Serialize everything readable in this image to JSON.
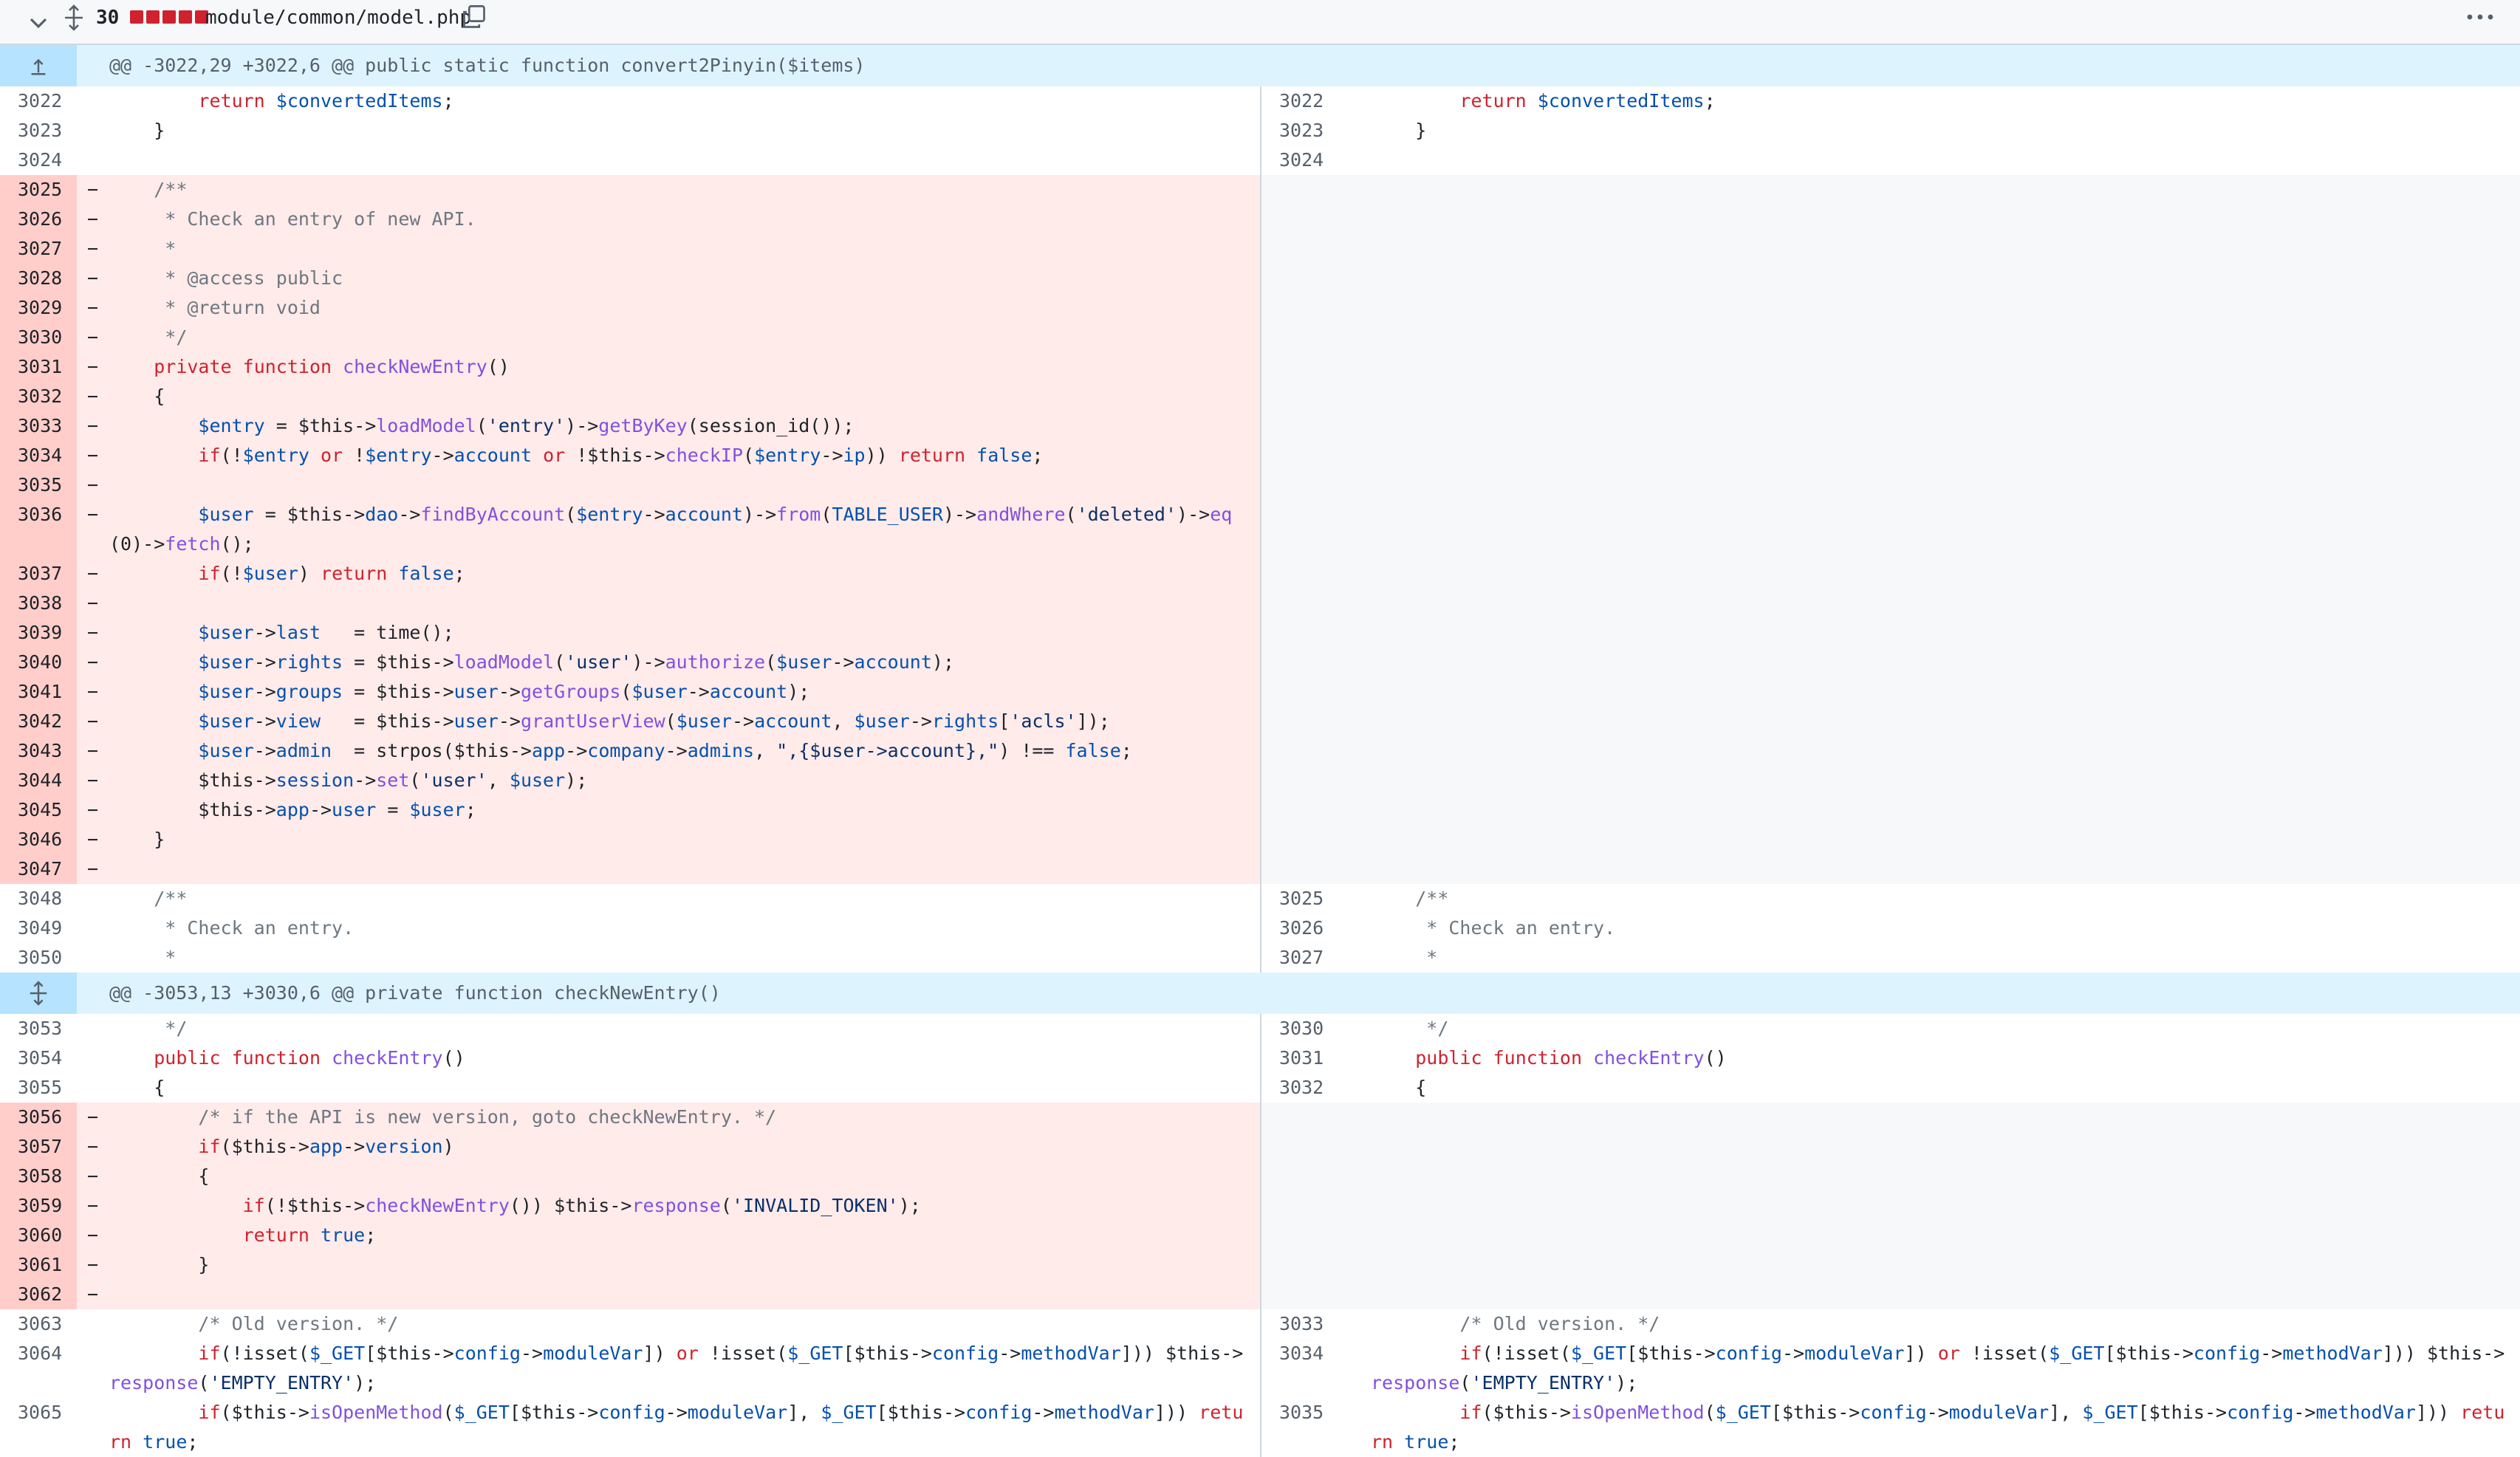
{
  "file": {
    "changes": "30",
    "path": "module/common/model.php",
    "colors": {
      "deleted": "#cf222e",
      "hunk_bg": "#ddf4ff",
      "del_bg": "#ffebe9",
      "del_gutter": "#ffcecb"
    }
  },
  "icons": {
    "collapse": "chevron-down-icon",
    "expand": "expand-vertical-icon",
    "copy": "copy-icon",
    "more": "kebab-horizontal-icon"
  },
  "rows": [
    {
      "t": "hunk",
      "text": "@@ -3022,29 +3022,6 @@ public static function convert2Pinyin($items)",
      "icon": "expand-up"
    },
    {
      "t": "ctx",
      "l": "3022",
      "r": "3022",
      "code": "        return $convertedItems;"
    },
    {
      "t": "ctx",
      "l": "3023",
      "r": "3023",
      "code": "    }"
    },
    {
      "t": "ctx",
      "l": "3024",
      "r": "3024",
      "code": ""
    },
    {
      "t": "del",
      "l": "3025",
      "code": "    /**"
    },
    {
      "t": "del",
      "l": "3026",
      "code": "     * Check an entry of new API."
    },
    {
      "t": "del",
      "l": "3027",
      "code": "     *"
    },
    {
      "t": "del",
      "l": "3028",
      "code": "     * @access public"
    },
    {
      "t": "del",
      "l": "3029",
      "code": "     * @return void"
    },
    {
      "t": "del",
      "l": "3030",
      "code": "     */"
    },
    {
      "t": "del",
      "l": "3031",
      "code": "    private function checkNewEntry()"
    },
    {
      "t": "del",
      "l": "3032",
      "code": "    {"
    },
    {
      "t": "del",
      "l": "3033",
      "code": "        $entry = $this->loadModel('entry')->getByKey(session_id());"
    },
    {
      "t": "del",
      "l": "3034",
      "code": "        if(!$entry or !$entry->account or !$this->checkIP($entry->ip)) return false;"
    },
    {
      "t": "del",
      "l": "3035",
      "code": ""
    },
    {
      "t": "del",
      "l": "3036",
      "code": "        $user = $this->dao->findByAccount($entry->account)->from(TABLE_USER)->andWhere('deleted')->eq(0)->fetch();",
      "lines": 2
    },
    {
      "t": "del",
      "l": "3037",
      "code": "        if(!$user) return false;"
    },
    {
      "t": "del",
      "l": "3038",
      "code": ""
    },
    {
      "t": "del",
      "l": "3039",
      "code": "        $user->last   = time();"
    },
    {
      "t": "del",
      "l": "3040",
      "code": "        $user->rights = $this->loadModel('user')->authorize($user->account);"
    },
    {
      "t": "del",
      "l": "3041",
      "code": "        $user->groups = $this->user->getGroups($user->account);"
    },
    {
      "t": "del",
      "l": "3042",
      "code": "        $user->view   = $this->user->grantUserView($user->account, $user->rights['acls']);"
    },
    {
      "t": "del",
      "l": "3043",
      "code": "        $user->admin  = strpos($this->app->company->admins, \",{$user->account},\") !== false;"
    },
    {
      "t": "del",
      "l": "3044",
      "code": "        $this->session->set('user', $user);"
    },
    {
      "t": "del",
      "l": "3045",
      "code": "        $this->app->user = $user;"
    },
    {
      "t": "del",
      "l": "3046",
      "code": "    }"
    },
    {
      "t": "del",
      "l": "3047",
      "code": ""
    },
    {
      "t": "ctx",
      "l": "3048",
      "r": "3025",
      "code": "    /**"
    },
    {
      "t": "ctx",
      "l": "3049",
      "r": "3026",
      "code": "     * Check an entry."
    },
    {
      "t": "ctx",
      "l": "3050",
      "r": "3027",
      "code": "     *"
    },
    {
      "t": "hunk",
      "text": "@@ -3053,13 +3030,6 @@ private function checkNewEntry()",
      "icon": "expand-both"
    },
    {
      "t": "ctx",
      "l": "3053",
      "r": "3030",
      "code": "     */"
    },
    {
      "t": "ctx",
      "l": "3054",
      "r": "3031",
      "code": "    public function checkEntry()"
    },
    {
      "t": "ctx",
      "l": "3055",
      "r": "3032",
      "code": "    {"
    },
    {
      "t": "del",
      "l": "3056",
      "code": "        /* if the API is new version, goto checkNewEntry. */"
    },
    {
      "t": "del",
      "l": "3057",
      "code": "        if($this->app->version)"
    },
    {
      "t": "del",
      "l": "3058",
      "code": "        {"
    },
    {
      "t": "del",
      "l": "3059",
      "code": "            if(!$this->checkNewEntry()) $this->response('INVALID_TOKEN');"
    },
    {
      "t": "del",
      "l": "3060",
      "code": "            return true;"
    },
    {
      "t": "del",
      "l": "3061",
      "code": "        }"
    },
    {
      "t": "del",
      "l": "3062",
      "code": ""
    },
    {
      "t": "ctx",
      "l": "3063",
      "r": "3033",
      "code": "        /* Old version. */"
    },
    {
      "t": "ctx",
      "l": "3064",
      "r": "3034",
      "code": "        if(!isset($_GET[$this->config->moduleVar]) or !isset($_GET[$this->config->methodVar])) $this->response('EMPTY_ENTRY');",
      "lines": 2
    },
    {
      "t": "ctx",
      "l": "3065",
      "r": "3035",
      "code": "        if($this->isOpenMethod($_GET[$this->config->moduleVar], $_GET[$this->config->methodVar])) return true;",
      "lines": 2
    }
  ]
}
